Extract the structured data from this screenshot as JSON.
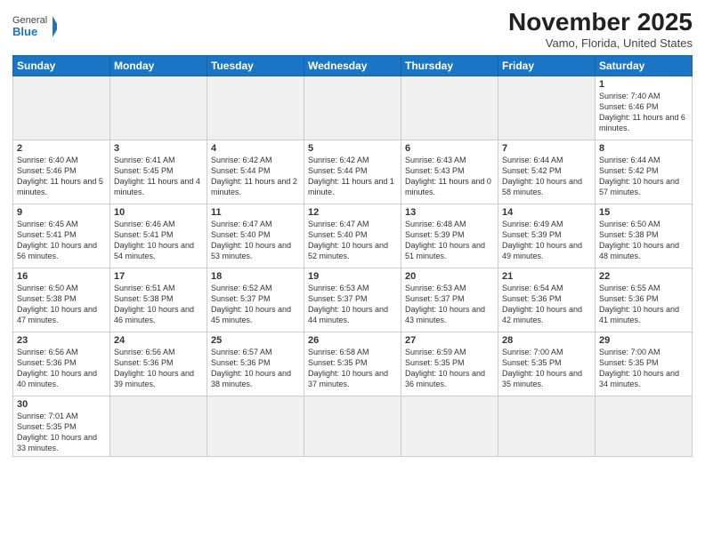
{
  "header": {
    "logo_general": "General",
    "logo_blue": "Blue",
    "title": "November 2025",
    "subtitle": "Vamo, Florida, United States"
  },
  "days_of_week": [
    "Sunday",
    "Monday",
    "Tuesday",
    "Wednesday",
    "Thursday",
    "Friday",
    "Saturday"
  ],
  "weeks": [
    [
      {
        "day": "",
        "info": "",
        "empty": true
      },
      {
        "day": "",
        "info": "",
        "empty": true
      },
      {
        "day": "",
        "info": "",
        "empty": true
      },
      {
        "day": "",
        "info": "",
        "empty": true
      },
      {
        "day": "",
        "info": "",
        "empty": true
      },
      {
        "day": "",
        "info": "",
        "empty": true
      },
      {
        "day": "1",
        "info": "Sunrise: 7:40 AM\nSunset: 6:46 PM\nDaylight: 11 hours\nand 6 minutes.",
        "empty": false
      }
    ],
    [
      {
        "day": "2",
        "info": "Sunrise: 6:40 AM\nSunset: 5:46 PM\nDaylight: 11 hours\nand 5 minutes.",
        "empty": false
      },
      {
        "day": "3",
        "info": "Sunrise: 6:41 AM\nSunset: 5:45 PM\nDaylight: 11 hours\nand 4 minutes.",
        "empty": false
      },
      {
        "day": "4",
        "info": "Sunrise: 6:42 AM\nSunset: 5:44 PM\nDaylight: 11 hours\nand 2 minutes.",
        "empty": false
      },
      {
        "day": "5",
        "info": "Sunrise: 6:42 AM\nSunset: 5:44 PM\nDaylight: 11 hours\nand 1 minute.",
        "empty": false
      },
      {
        "day": "6",
        "info": "Sunrise: 6:43 AM\nSunset: 5:43 PM\nDaylight: 11 hours\nand 0 minutes.",
        "empty": false
      },
      {
        "day": "7",
        "info": "Sunrise: 6:44 AM\nSunset: 5:42 PM\nDaylight: 10 hours\nand 58 minutes.",
        "empty": false
      },
      {
        "day": "8",
        "info": "Sunrise: 6:44 AM\nSunset: 5:42 PM\nDaylight: 10 hours\nand 57 minutes.",
        "empty": false
      }
    ],
    [
      {
        "day": "9",
        "info": "Sunrise: 6:45 AM\nSunset: 5:41 PM\nDaylight: 10 hours\nand 56 minutes.",
        "empty": false
      },
      {
        "day": "10",
        "info": "Sunrise: 6:46 AM\nSunset: 5:41 PM\nDaylight: 10 hours\nand 54 minutes.",
        "empty": false
      },
      {
        "day": "11",
        "info": "Sunrise: 6:47 AM\nSunset: 5:40 PM\nDaylight: 10 hours\nand 53 minutes.",
        "empty": false
      },
      {
        "day": "12",
        "info": "Sunrise: 6:47 AM\nSunset: 5:40 PM\nDaylight: 10 hours\nand 52 minutes.",
        "empty": false
      },
      {
        "day": "13",
        "info": "Sunrise: 6:48 AM\nSunset: 5:39 PM\nDaylight: 10 hours\nand 51 minutes.",
        "empty": false
      },
      {
        "day": "14",
        "info": "Sunrise: 6:49 AM\nSunset: 5:39 PM\nDaylight: 10 hours\nand 49 minutes.",
        "empty": false
      },
      {
        "day": "15",
        "info": "Sunrise: 6:50 AM\nSunset: 5:38 PM\nDaylight: 10 hours\nand 48 minutes.",
        "empty": false
      }
    ],
    [
      {
        "day": "16",
        "info": "Sunrise: 6:50 AM\nSunset: 5:38 PM\nDaylight: 10 hours\nand 47 minutes.",
        "empty": false
      },
      {
        "day": "17",
        "info": "Sunrise: 6:51 AM\nSunset: 5:38 PM\nDaylight: 10 hours\nand 46 minutes.",
        "empty": false
      },
      {
        "day": "18",
        "info": "Sunrise: 6:52 AM\nSunset: 5:37 PM\nDaylight: 10 hours\nand 45 minutes.",
        "empty": false
      },
      {
        "day": "19",
        "info": "Sunrise: 6:53 AM\nSunset: 5:37 PM\nDaylight: 10 hours\nand 44 minutes.",
        "empty": false
      },
      {
        "day": "20",
        "info": "Sunrise: 6:53 AM\nSunset: 5:37 PM\nDaylight: 10 hours\nand 43 minutes.",
        "empty": false
      },
      {
        "day": "21",
        "info": "Sunrise: 6:54 AM\nSunset: 5:36 PM\nDaylight: 10 hours\nand 42 minutes.",
        "empty": false
      },
      {
        "day": "22",
        "info": "Sunrise: 6:55 AM\nSunset: 5:36 PM\nDaylight: 10 hours\nand 41 minutes.",
        "empty": false
      }
    ],
    [
      {
        "day": "23",
        "info": "Sunrise: 6:56 AM\nSunset: 5:36 PM\nDaylight: 10 hours\nand 40 minutes.",
        "empty": false
      },
      {
        "day": "24",
        "info": "Sunrise: 6:56 AM\nSunset: 5:36 PM\nDaylight: 10 hours\nand 39 minutes.",
        "empty": false
      },
      {
        "day": "25",
        "info": "Sunrise: 6:57 AM\nSunset: 5:36 PM\nDaylight: 10 hours\nand 38 minutes.",
        "empty": false
      },
      {
        "day": "26",
        "info": "Sunrise: 6:58 AM\nSunset: 5:35 PM\nDaylight: 10 hours\nand 37 minutes.",
        "empty": false
      },
      {
        "day": "27",
        "info": "Sunrise: 6:59 AM\nSunset: 5:35 PM\nDaylight: 10 hours\nand 36 minutes.",
        "empty": false
      },
      {
        "day": "28",
        "info": "Sunrise: 7:00 AM\nSunset: 5:35 PM\nDaylight: 10 hours\nand 35 minutes.",
        "empty": false
      },
      {
        "day": "29",
        "info": "Sunrise: 7:00 AM\nSunset: 5:35 PM\nDaylight: 10 hours\nand 34 minutes.",
        "empty": false
      }
    ],
    [
      {
        "day": "30",
        "info": "Sunrise: 7:01 AM\nSunset: 5:35 PM\nDaylight: 10 hours\nand 33 minutes.",
        "empty": false
      },
      {
        "day": "",
        "info": "",
        "empty": true
      },
      {
        "day": "",
        "info": "",
        "empty": true
      },
      {
        "day": "",
        "info": "",
        "empty": true
      },
      {
        "day": "",
        "info": "",
        "empty": true
      },
      {
        "day": "",
        "info": "",
        "empty": true
      },
      {
        "day": "",
        "info": "",
        "empty": true
      }
    ]
  ]
}
